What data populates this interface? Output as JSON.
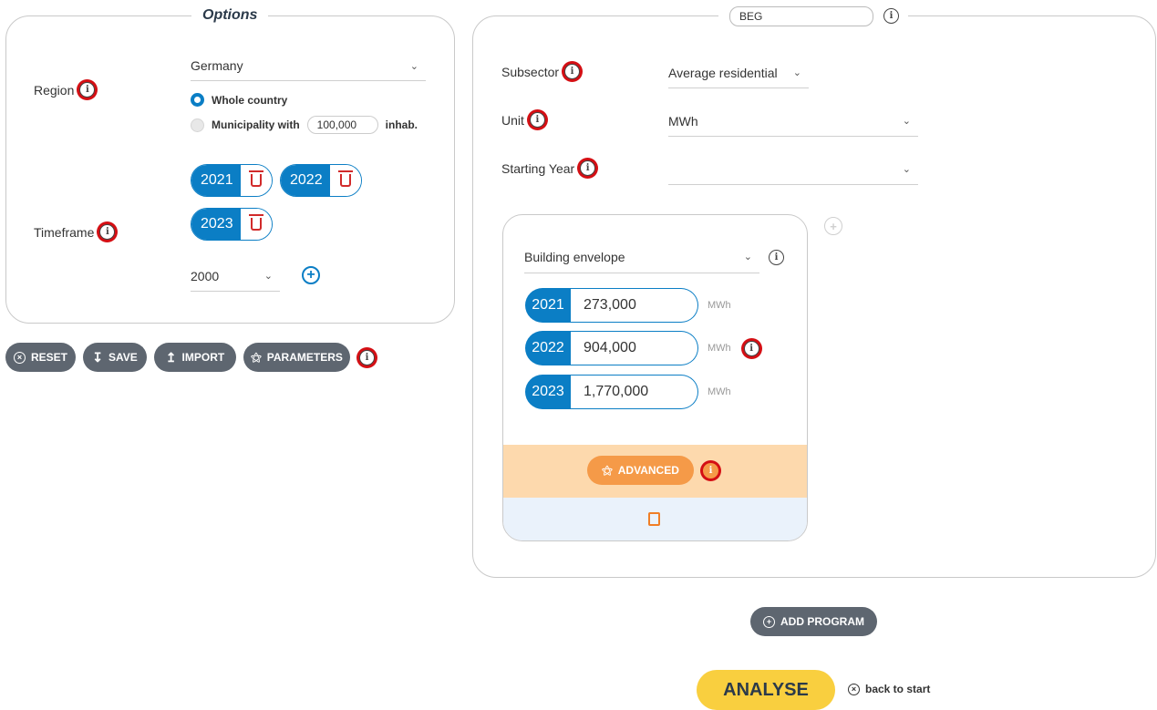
{
  "options": {
    "title": "Options",
    "region_label": "Region",
    "region_value": "Germany",
    "radio_whole": "Whole country",
    "radio_municipality": "Municipality with",
    "municipality_value": "100,000",
    "municipality_unit": "inhab.",
    "timeframe_label": "Timeframe",
    "years": [
      "2021",
      "2022",
      "2023"
    ],
    "year_select": "2000"
  },
  "toolbar": {
    "reset": "RESET",
    "save": "SAVE",
    "import": "IMPORT",
    "parameters": "PARAMETERS"
  },
  "program": {
    "name": "BEG",
    "subsector_label": "Subsector",
    "subsector_value": "Average residential",
    "unit_label": "Unit",
    "unit_value": "MWh",
    "starting_year_label": "Starting Year",
    "starting_year_value": "",
    "measure": {
      "type": "Building envelope",
      "rows": [
        {
          "year": "2021",
          "value": "273,000",
          "unit": "MWh"
        },
        {
          "year": "2022",
          "value": "904,000",
          "unit": "MWh"
        },
        {
          "year": "2023",
          "value": "1,770,000",
          "unit": "MWh"
        }
      ],
      "advanced": "ADVANCED"
    }
  },
  "add_program": "ADD PROGRAM",
  "analyse": "ANALYSE",
  "back_to_start": "back to start",
  "colors": {
    "accent": "#0b7ec5",
    "delete": "#d12a2a",
    "advanced": "#f59a48",
    "analyse": "#f9cf3f",
    "button": "#5e6670"
  }
}
